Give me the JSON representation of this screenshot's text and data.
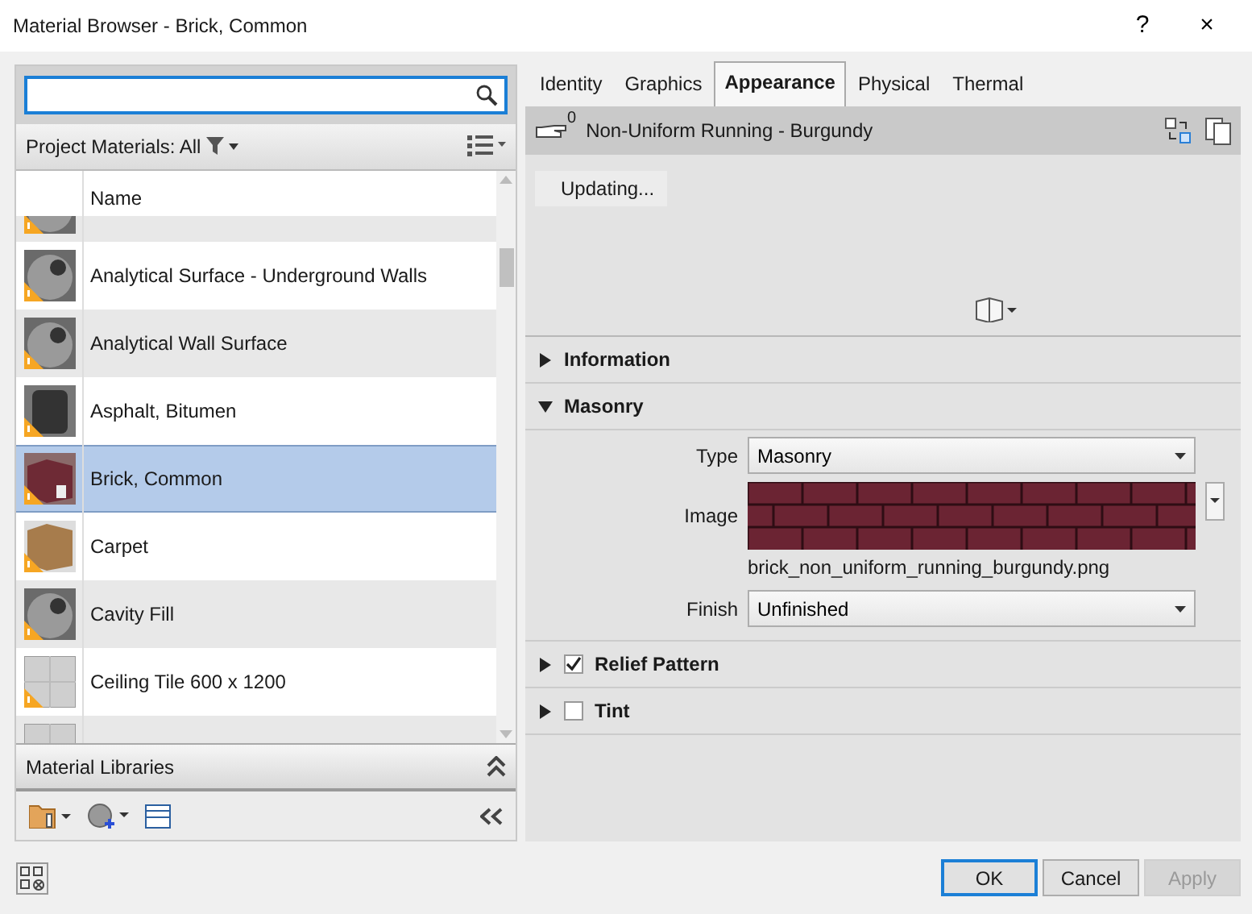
{
  "window": {
    "title": "Material Browser - Brick, Common",
    "help": "?",
    "close": "×"
  },
  "filter": {
    "label": "Project Materials: All"
  },
  "list": {
    "column": "Name",
    "rows": [
      {
        "kind": "sphere",
        "warning": true,
        "selected": false
      },
      {
        "name": "Analytical Surface - Underground Walls",
        "kind": "sphere",
        "warning": true,
        "selected": false
      },
      {
        "name": "Analytical Wall Surface",
        "kind": "sphere",
        "warning": true,
        "selected": false
      },
      {
        "name": "Asphalt, Bitumen",
        "kind": "cylinder",
        "warning": true,
        "selected": false
      },
      {
        "name": "Brick, Common",
        "kind": "brick",
        "warning": true,
        "selected": true
      },
      {
        "name": "Carpet",
        "kind": "carpet",
        "warning": true,
        "selected": false
      },
      {
        "name": "Cavity Fill",
        "kind": "sphere",
        "warning": true,
        "selected": false
      },
      {
        "name": "Ceiling Tile 600 x 1200",
        "kind": "tile",
        "warning": true,
        "selected": false
      },
      {
        "kind": "tile",
        "warning": false,
        "selected": false
      }
    ]
  },
  "libraries": {
    "title": "Material Libraries"
  },
  "tabs": [
    {
      "label": "Identity",
      "selected": false
    },
    {
      "label": "Graphics",
      "selected": false
    },
    {
      "label": "Appearance",
      "selected": true
    },
    {
      "label": "Physical",
      "selected": false
    },
    {
      "label": "Thermal",
      "selected": false
    }
  ],
  "asset": {
    "name": "Non-Uniform Running - Burgundy",
    "usage_count": "0",
    "status": "Updating..."
  },
  "sections": [
    {
      "title": "Information",
      "expanded": false
    },
    {
      "title": "Masonry",
      "expanded": true,
      "properties": [
        {
          "kind": "dropdown",
          "label": "Type",
          "value": "Masonry"
        },
        {
          "kind": "image",
          "label": "Image",
          "filename": "brick_non_uniform_running_burgundy.png"
        },
        {
          "kind": "dropdown",
          "label": "Finish",
          "value": "Unfinished"
        }
      ]
    },
    {
      "title": "Relief Pattern",
      "expanded": false,
      "checked": true
    },
    {
      "title": "Tint",
      "expanded": false,
      "checked": false
    }
  ],
  "buttons": [
    {
      "label": "OK",
      "kind": "default",
      "disabled": false
    },
    {
      "label": "Cancel",
      "kind": "normal",
      "disabled": false
    },
    {
      "label": "Apply",
      "kind": "normal",
      "disabled": true
    }
  ]
}
